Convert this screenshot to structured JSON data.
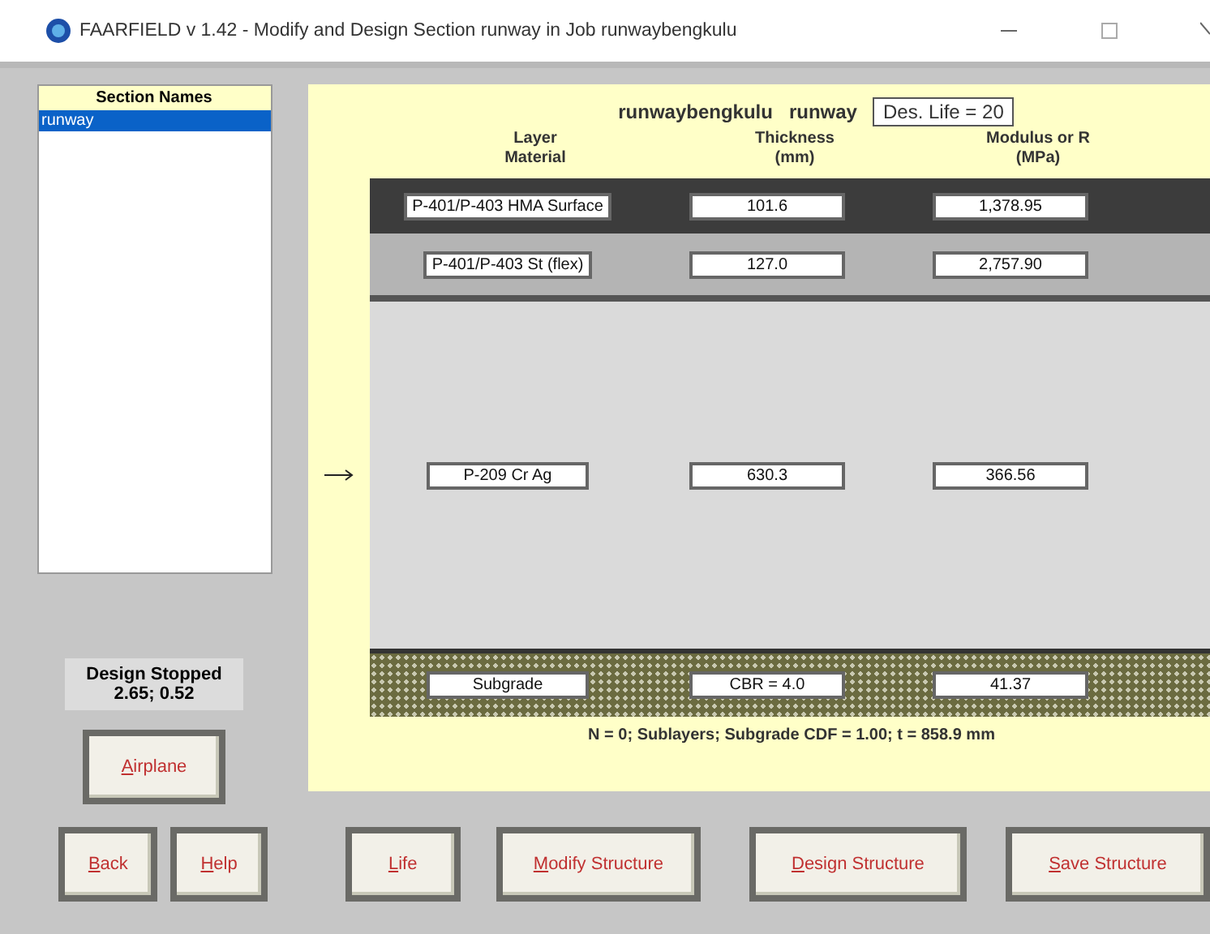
{
  "window": {
    "title": "FAARFIELD v 1.42 - Modify and Design Section runway in Job runwaybengkulu"
  },
  "sections": {
    "heading": "Section Names",
    "items": [
      {
        "label": "runway",
        "selected": true
      }
    ]
  },
  "status": {
    "line1": "Design Stopped",
    "line2": "2.65;  0.52"
  },
  "structure": {
    "job": "runwaybengkulu",
    "section": "runway",
    "life": "Des. Life = 20",
    "columns": [
      {
        "line1": "Layer",
        "line2": "Material"
      },
      {
        "line1": "Thickness",
        "line2": "(mm)"
      },
      {
        "line1": "Modulus or R",
        "line2": "(MPa)"
      }
    ],
    "layers": [
      {
        "kind": "surface",
        "material": "P-401/P-403 HMA Surface",
        "thickness": "101.6",
        "modulus": "1,378.95",
        "selected": false
      },
      {
        "kind": "base",
        "material": "P-401/P-403 St (flex)",
        "thickness": "127.0",
        "modulus": "2,757.90",
        "selected": false
      },
      {
        "kind": "subbase",
        "material": "P-209 Cr Ag",
        "thickness": "630.3",
        "modulus": "366.56",
        "selected": true
      },
      {
        "kind": "subgrade",
        "material": "Subgrade",
        "thickness": "CBR = 4.0",
        "modulus": "41.37",
        "selected": false
      }
    ],
    "summary": "N = 0;  Sublayers;  Subgrade CDF = 1.00;  t = 858.9 mm"
  },
  "side_buttons": [
    "Airplane"
  ],
  "buttons": [
    "Back",
    "Help",
    "Life",
    "Modify Structure",
    "Design Structure",
    "Save Structure"
  ]
}
